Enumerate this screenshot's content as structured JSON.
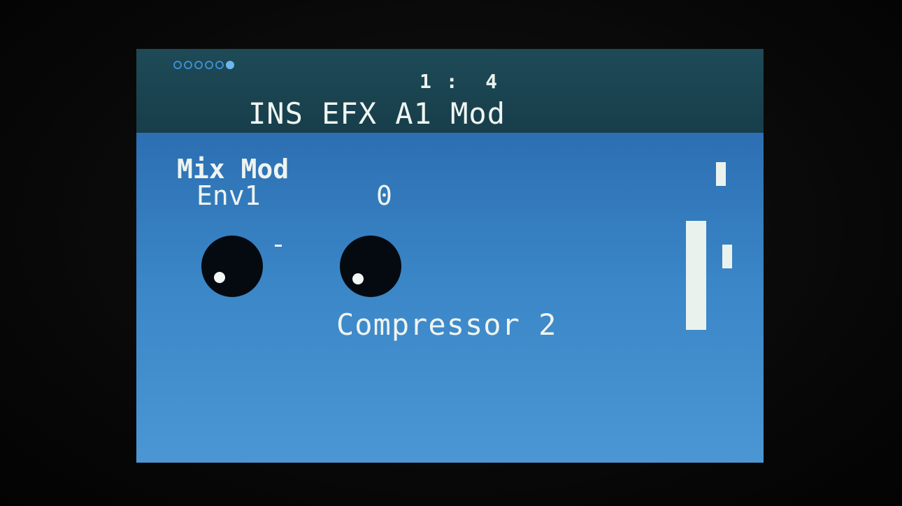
{
  "header": {
    "page_dots_total": 6,
    "page_dots_active": 6,
    "position_text": "1 :  4",
    "title": "INS EFX A1 Mod"
  },
  "main": {
    "parameter_name": "Mix Mod",
    "source_label": "Env1",
    "amount_value": "0",
    "effect_name": "Compressor 2",
    "knobs": [
      {
        "name": "source-knob",
        "icon": "knob-icon"
      },
      {
        "name": "amount-knob",
        "icon": "knob-icon"
      }
    ],
    "minus_sign": "-"
  },
  "colors": {
    "screen_background": "#2f78bd",
    "header_background": "#1e4a57",
    "text": "#eef4f1",
    "knob": "#050a10",
    "page_dot": "#3d8fd0"
  }
}
